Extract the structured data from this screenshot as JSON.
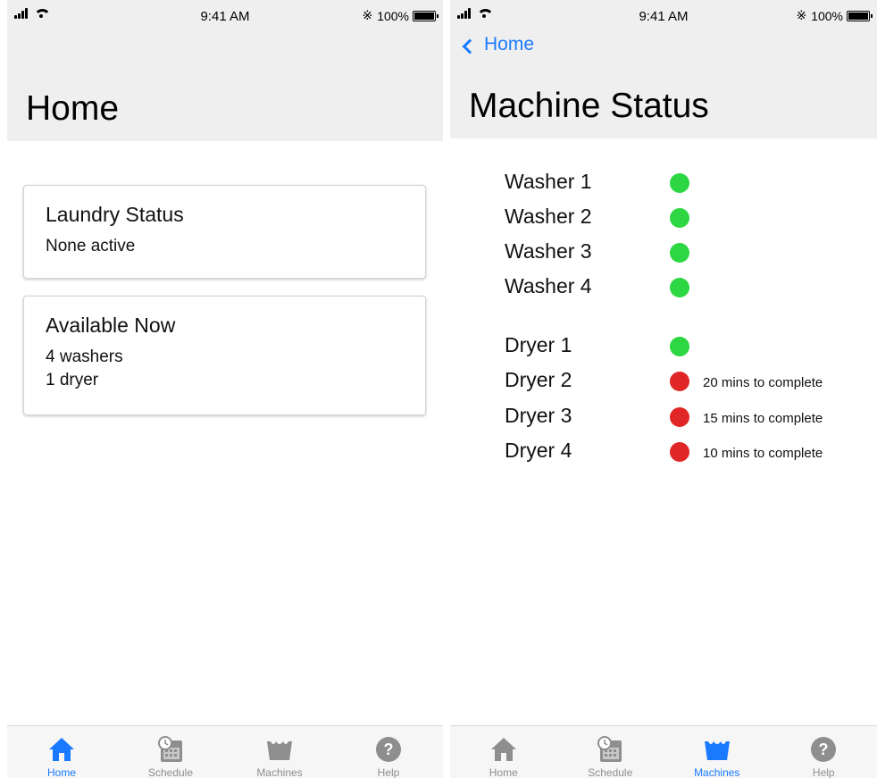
{
  "status_bar": {
    "time": "9:41 AM",
    "battery": "100%",
    "battery_level": 1.0
  },
  "home_screen": {
    "title": "Home",
    "cards": [
      {
        "title": "Laundry Status",
        "lines": [
          "None active"
        ]
      },
      {
        "title": "Available Now",
        "lines": [
          "4 washers",
          "1 dryer"
        ]
      }
    ]
  },
  "machine_screen": {
    "back_label": "Home",
    "title": "Machine Status",
    "washers": [
      {
        "name": "Washer 1",
        "status": "available",
        "note": ""
      },
      {
        "name": "Washer 2",
        "status": "available",
        "note": ""
      },
      {
        "name": "Washer 3",
        "status": "available",
        "note": ""
      },
      {
        "name": "Washer 4",
        "status": "available",
        "note": ""
      }
    ],
    "dryers": [
      {
        "name": "Dryer 1",
        "status": "available",
        "note": ""
      },
      {
        "name": "Dryer 2",
        "status": "busy",
        "note": "20 mins to complete"
      },
      {
        "name": "Dryer 3",
        "status": "busy",
        "note": "15 mins to complete"
      },
      {
        "name": "Dryer 4",
        "status": "busy",
        "note": "10 mins to complete"
      }
    ]
  },
  "tab_bar": {
    "tabs": [
      {
        "label": "Home",
        "icon": "house-icon"
      },
      {
        "label": "Schedule",
        "icon": "calendar-clock-icon"
      },
      {
        "label": "Machines",
        "icon": "washtub-icon"
      },
      {
        "label": "Help",
        "icon": "help-icon"
      }
    ]
  },
  "colors": {
    "accent": "#1a7aff",
    "available": "#2dd643",
    "busy": "#e02626",
    "inactive_icon": "#8e8e8e",
    "nav_background": "#efefef"
  }
}
